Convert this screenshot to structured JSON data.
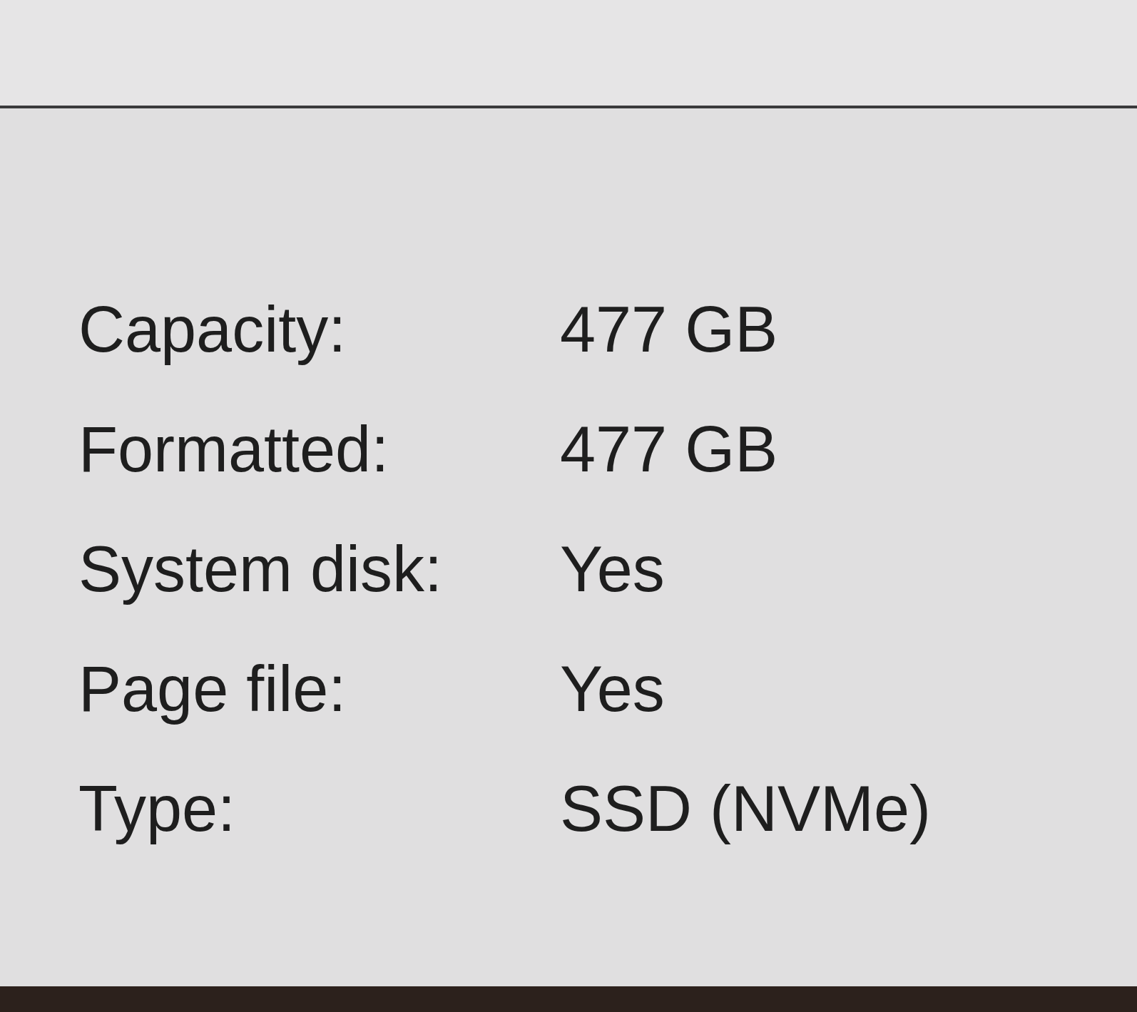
{
  "properties": [
    {
      "label": "Capacity:",
      "value": "477 GB"
    },
    {
      "label": "Formatted:",
      "value": "477 GB"
    },
    {
      "label": "System disk:",
      "value": "Yes"
    },
    {
      "label": "Page file:",
      "value": "Yes"
    },
    {
      "label": "Type:",
      "value": "SSD (NVMe)"
    }
  ]
}
